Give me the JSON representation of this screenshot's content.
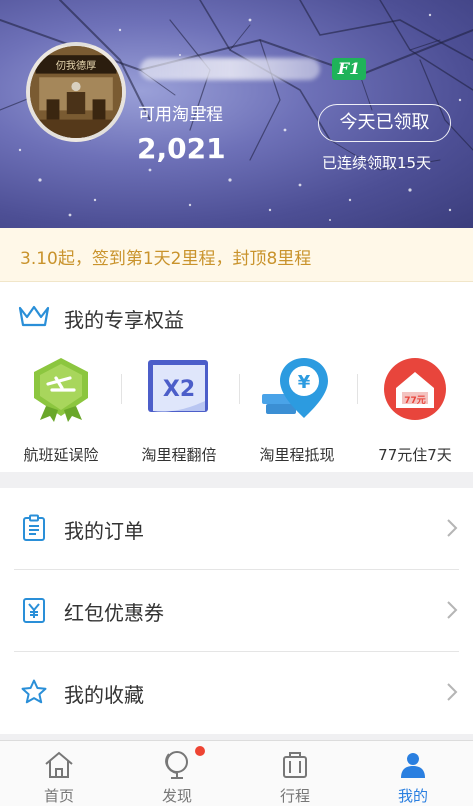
{
  "header": {
    "badge": "F1",
    "miles_label": "可用淘里程",
    "miles_value": "2,021",
    "claim_button": "今天已领取",
    "streak": "已连续领取15天",
    "avatar_sign_text": "仞我德厚"
  },
  "notice": {
    "text": "3.10起，签到第1天2里程，封顶8里程"
  },
  "benefits": {
    "title": "我的专享权益",
    "items": [
      {
        "label": "航班延误险",
        "icon": "flight-delay-shield-icon"
      },
      {
        "label": "淘里程翻倍",
        "icon": "x2-card-icon",
        "icon_text": "X2"
      },
      {
        "label": "淘里程抵现",
        "icon": "yuan-pin-icon",
        "icon_text": "¥"
      },
      {
        "label": "77元住7天",
        "icon": "hotel-house-icon",
        "icon_text": "77元"
      }
    ]
  },
  "list": [
    {
      "label": "我的订单",
      "icon": "clipboard-icon"
    },
    {
      "label": "红包优惠券",
      "icon": "coupon-yuan-icon"
    },
    {
      "label": "我的收藏",
      "icon": "star-icon"
    }
  ],
  "tabs": [
    {
      "label": "首页",
      "icon": "home-icon"
    },
    {
      "label": "发现",
      "icon": "globe-icon",
      "has_dot": true
    },
    {
      "label": "行程",
      "icon": "luggage-icon"
    },
    {
      "label": "我的",
      "icon": "user-icon",
      "active": true
    }
  ],
  "colors": {
    "accent": "#2a7fe0",
    "notice_text": "#c9932c",
    "badge_green": "#1fb35a",
    "tab_dot": "#ee4433"
  }
}
